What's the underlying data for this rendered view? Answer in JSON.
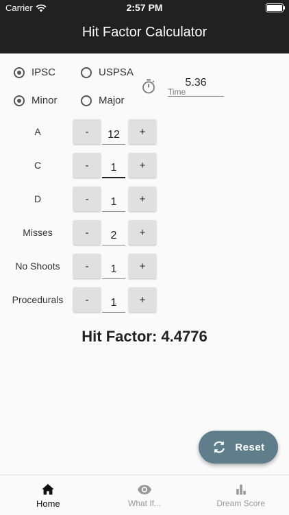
{
  "status_bar": {
    "carrier": "Carrier",
    "time": "2:57 PM"
  },
  "app_bar": {
    "title": "Hit Factor Calculator"
  },
  "division": {
    "options": [
      {
        "label": "IPSC",
        "selected": true
      },
      {
        "label": "USPSA",
        "selected": false
      }
    ]
  },
  "power_factor": {
    "options": [
      {
        "label": "Minor",
        "selected": true
      },
      {
        "label": "Major",
        "selected": false
      }
    ]
  },
  "time_field": {
    "value": "5.36",
    "label": "Time"
  },
  "scores": [
    {
      "label": "A",
      "value": "12"
    },
    {
      "label": "C",
      "value": "1"
    },
    {
      "label": "D",
      "value": "1"
    },
    {
      "label": "Misses",
      "value": "2"
    },
    {
      "label": "No Shoots",
      "value": "1"
    },
    {
      "label": "Procedurals",
      "value": "1"
    }
  ],
  "controls": {
    "minus": "-",
    "plus": "+"
  },
  "result": {
    "text": "Hit Factor: 4.4776"
  },
  "reset_button": {
    "label": "Reset"
  },
  "bottom_nav": {
    "items": [
      {
        "label": "Home"
      },
      {
        "label": "What If..."
      },
      {
        "label": "Dream Score"
      }
    ]
  }
}
